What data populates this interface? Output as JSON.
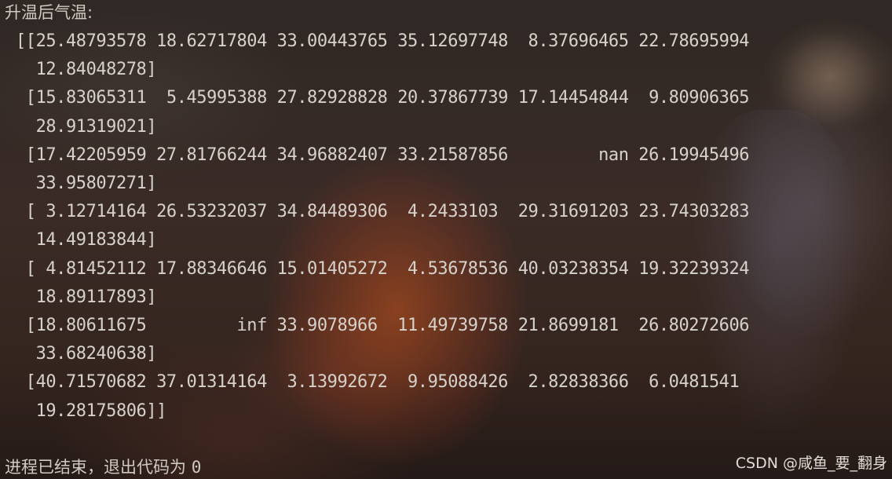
{
  "terminal": {
    "heading": "升温后气温:",
    "lines": [
      "[[25.48793578 18.62717804 33.00443765 35.12697748  8.37696465 22.78695994",
      "  12.84048278]",
      " [15.83065311  5.45995388 27.82928828 20.37867739 17.14454844  9.80906365",
      "  28.91319021]",
      " [17.42205959 27.81766244 34.96882407 33.21587856         nan 26.19945496",
      "  33.95807271]",
      " [ 3.12714164 26.53232037 34.84489306  4.2433103  29.31691203 23.74303283",
      "  14.49183844]",
      " [ 4.81452112 17.88346646 15.01405272  4.53678536 40.03238354 19.32239324",
      "  18.89117893]",
      " [18.80611675         inf 33.9078966  11.49739758 21.8699181  26.80272606",
      "  33.68240638]",
      " [40.71570682 37.01314164  3.13992672  9.95088426  2.82838366  6.0481541",
      "  19.28175806]]"
    ],
    "exit_message": "进程已结束，退出代码为",
    "exit_code": "0"
  },
  "watermark": "CSDN @咸鱼_要_翻身"
}
